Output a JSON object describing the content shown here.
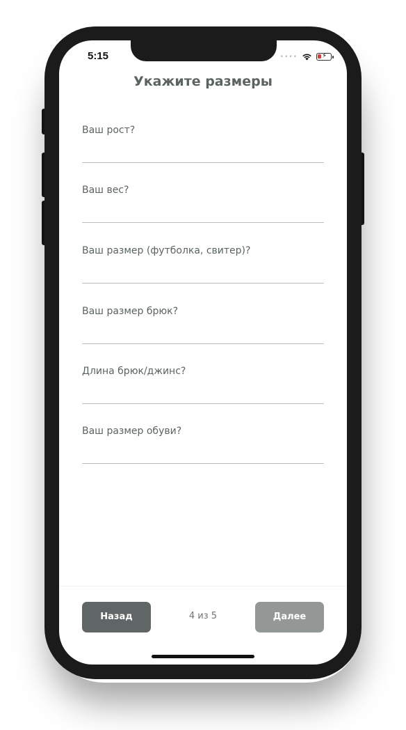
{
  "status_bar": {
    "time": "5:15",
    "icons": [
      "signal-dots-icon",
      "wifi-icon",
      "battery-charging-icon"
    ]
  },
  "page": {
    "title": "Укажите размеры"
  },
  "fields": [
    {
      "label": "Ваш рост?",
      "value": ""
    },
    {
      "label": "Ваш вес?",
      "value": ""
    },
    {
      "label": "Ваш размер (футболка, свитер)?",
      "value": ""
    },
    {
      "label": "Ваш размер брюк?",
      "value": ""
    },
    {
      "label": "Длина брюк/джинс?",
      "value": ""
    },
    {
      "label": "Ваш размер обуви?",
      "value": ""
    }
  ],
  "footer": {
    "back_label": "Назад",
    "next_label": "Далее",
    "step_text": "4 из 5"
  },
  "colors": {
    "primary_button": "#5f6665",
    "disabled_button": "#939897",
    "text": "#5b6362",
    "battery_low": "#e53935"
  }
}
